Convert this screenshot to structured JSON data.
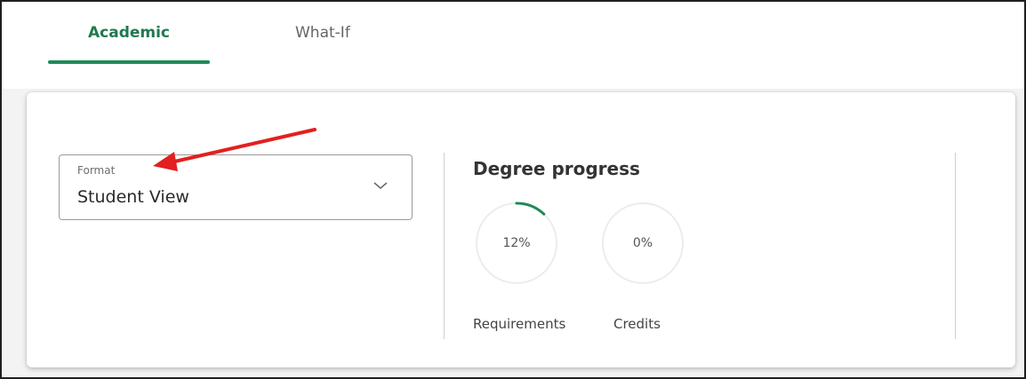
{
  "tabs": {
    "academic": "Academic",
    "what_if": "What-If",
    "active": "Academic"
  },
  "format": {
    "label": "Format",
    "value": "Student View",
    "icon": "chevron-down-icon"
  },
  "degree_progress": {
    "title": "Degree progress",
    "requirements": {
      "percent_text": "12%",
      "percent_value": 12,
      "label": "Requirements"
    },
    "credits": {
      "percent_text": "0%",
      "percent_value": 0,
      "label": "Credits"
    }
  },
  "colors": {
    "accent_green": "#1f8a58",
    "tab_active_text": "#1f7a4f",
    "annotation_arrow": "#e32020"
  }
}
